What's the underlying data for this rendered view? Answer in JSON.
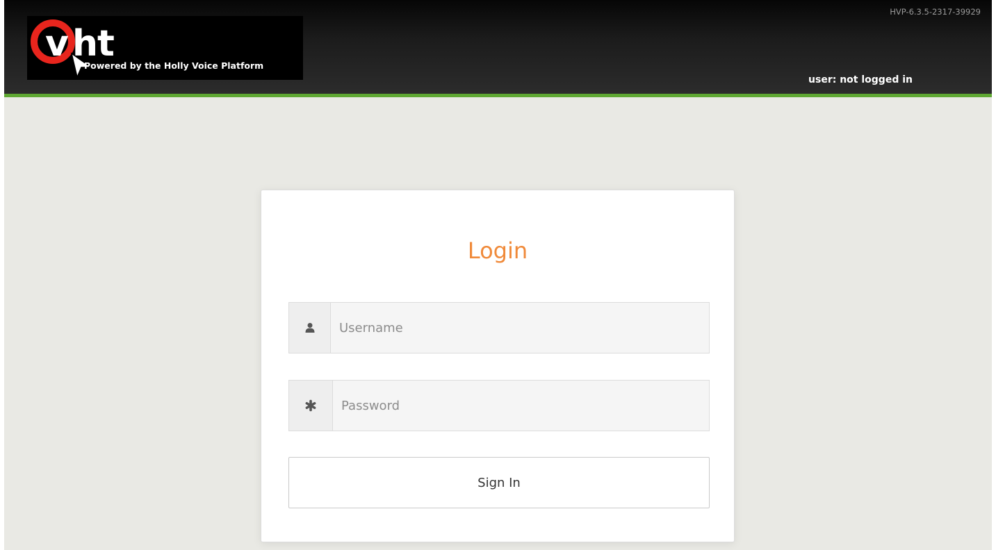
{
  "header": {
    "logo_word_prefix": "v",
    "logo_word_suffix": "ht",
    "logo_tagline": "Powered by the Holly Voice Platform",
    "version": "HVP-6.3.5-2317-39929",
    "user_status": "user: not logged in"
  },
  "login": {
    "title": "Login",
    "username": {
      "icon": "user-icon",
      "placeholder": "Username",
      "value": ""
    },
    "password": {
      "icon": "asterisk-icon",
      "placeholder": "Password",
      "value": ""
    },
    "submit_label": "Sign In"
  },
  "colors": {
    "header_background": "#1b1b1b",
    "header_accent": "#5fa833",
    "logo_ring": "#e8251d",
    "title": "#f08a3a",
    "page_background": "#e9e9e4"
  }
}
